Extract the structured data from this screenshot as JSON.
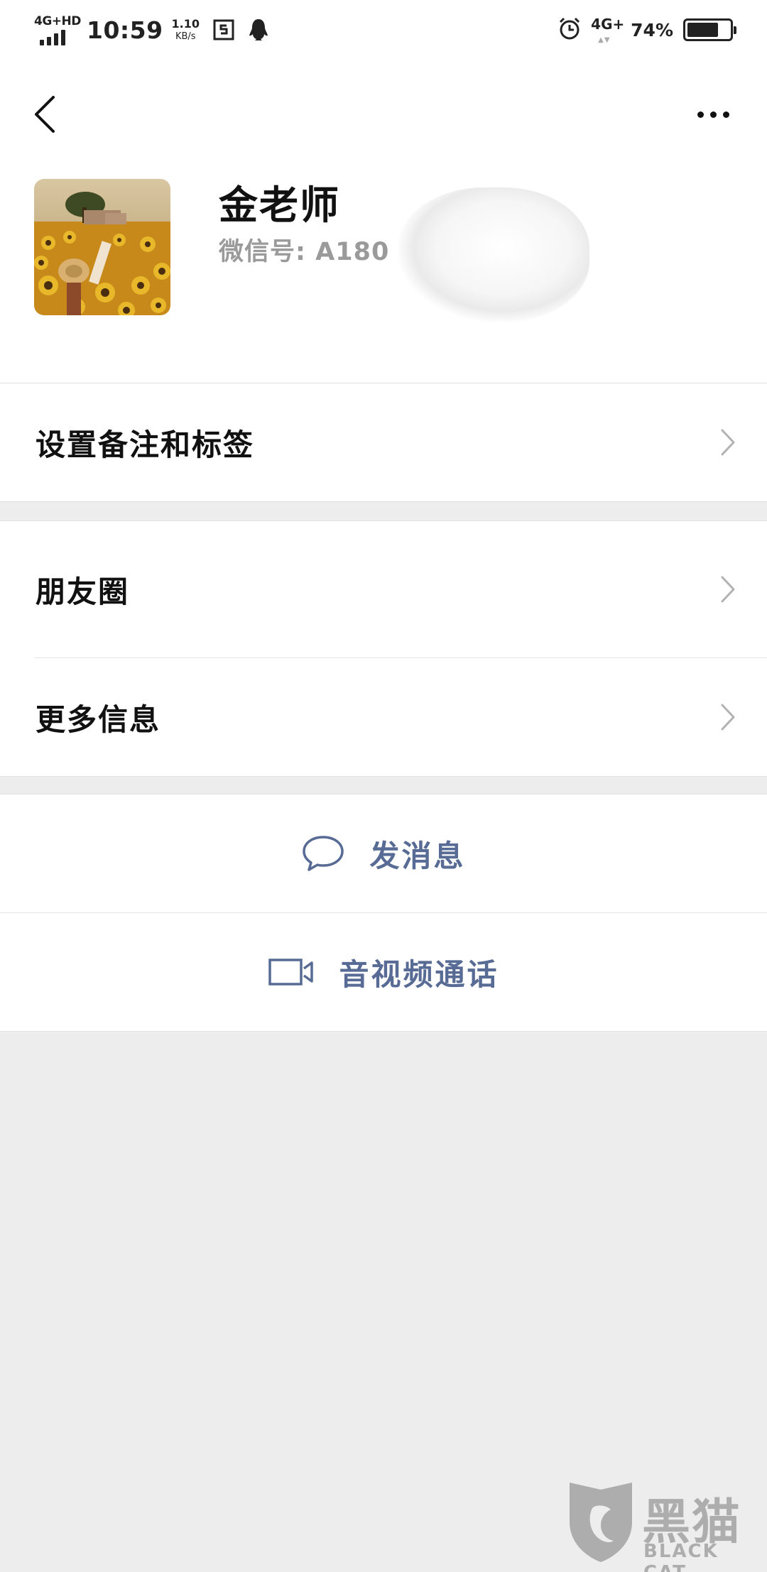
{
  "status_bar": {
    "network_left": "4G+HD",
    "time": "10:59",
    "speed_value": "1.10",
    "speed_unit": "KB/s",
    "network_right": "4G+",
    "battery_text": "74%",
    "battery_level": 0.74,
    "icons": [
      "signal-icon",
      "screenshot-app-icon",
      "qq-penguin-icon",
      "alarm-icon",
      "battery-icon"
    ]
  },
  "nav": {
    "back_icon": "chevron-left-icon",
    "more_icon": "more-dots-icon"
  },
  "profile": {
    "name": "金老师",
    "wechat_id": "微信号: A180"
  },
  "menu": {
    "remarks_label": "设置备注和标签",
    "moments_label": "朋友圈",
    "more_info_label": "更多信息"
  },
  "actions": {
    "message_label": "发消息",
    "call_label": "音视频通话"
  },
  "watermark": {
    "title": "黑猫",
    "subtitle": "BLACK CAT"
  },
  "colors": {
    "link_blue": "#576b95",
    "background": "#ededed",
    "cell_bg": "#ffffff"
  }
}
